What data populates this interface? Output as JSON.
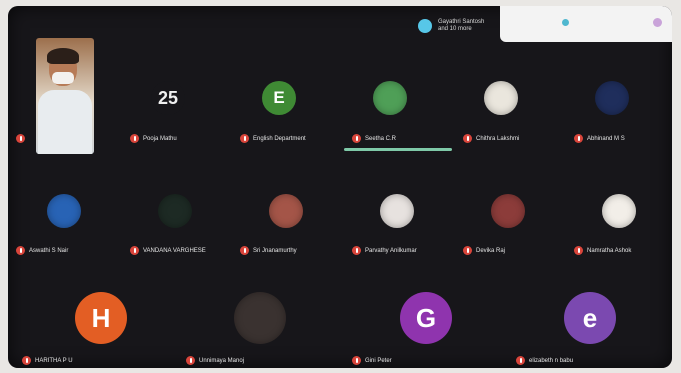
{
  "header": {
    "chip_text": "Gayathri Santosh\nand 10 more",
    "colors": {
      "chip_dot": "#57c7e8",
      "panel": "#f3f3f3"
    }
  },
  "participants": [
    {
      "name": "",
      "avatar": "video",
      "color": "#b77b57"
    },
    {
      "name": "Pooja Mathu",
      "avatar": "image",
      "color": "#f0f0f0",
      "initial": "25"
    },
    {
      "name": "English Department",
      "avatar": "letter",
      "color": "#3f8a34",
      "initial": "E"
    },
    {
      "name": "Seetha C.R",
      "avatar": "image",
      "color": "#4f9f57",
      "speaking": true
    },
    {
      "name": "Chithra Lakshmi",
      "avatar": "image",
      "color": "#eae6dd"
    },
    {
      "name": "Abhinand M S",
      "avatar": "image",
      "color": "#1f2e5c"
    },
    {
      "name": "Aswathi S Nair",
      "avatar": "image",
      "color": "#2863b5"
    },
    {
      "name": "VANDANA VARGHESE",
      "avatar": "image",
      "color": "#1d2a24"
    },
    {
      "name": "Sri Jnanamurthy",
      "avatar": "image",
      "color": "#a45548"
    },
    {
      "name": "Parvathy Anilkumar",
      "avatar": "image",
      "color": "#e7e2df"
    },
    {
      "name": "Devika Raj",
      "avatar": "image",
      "color": "#8c3c3a"
    },
    {
      "name": "Namratha Ashok",
      "avatar": "image",
      "color": "#f2eee8"
    },
    {
      "name": "HARITHA P U",
      "avatar": "letter",
      "color": "#e35e24",
      "initial": "H"
    },
    {
      "name": "Unnimaya Manoj",
      "avatar": "image",
      "color": "#3a3230"
    },
    {
      "name": "Gini Peter",
      "avatar": "letter",
      "color": "#8f34ae",
      "initial": "G"
    },
    {
      "name": "elizabeth n babu",
      "avatar": "letter",
      "color": "#7b49b0",
      "initial": "e"
    }
  ]
}
